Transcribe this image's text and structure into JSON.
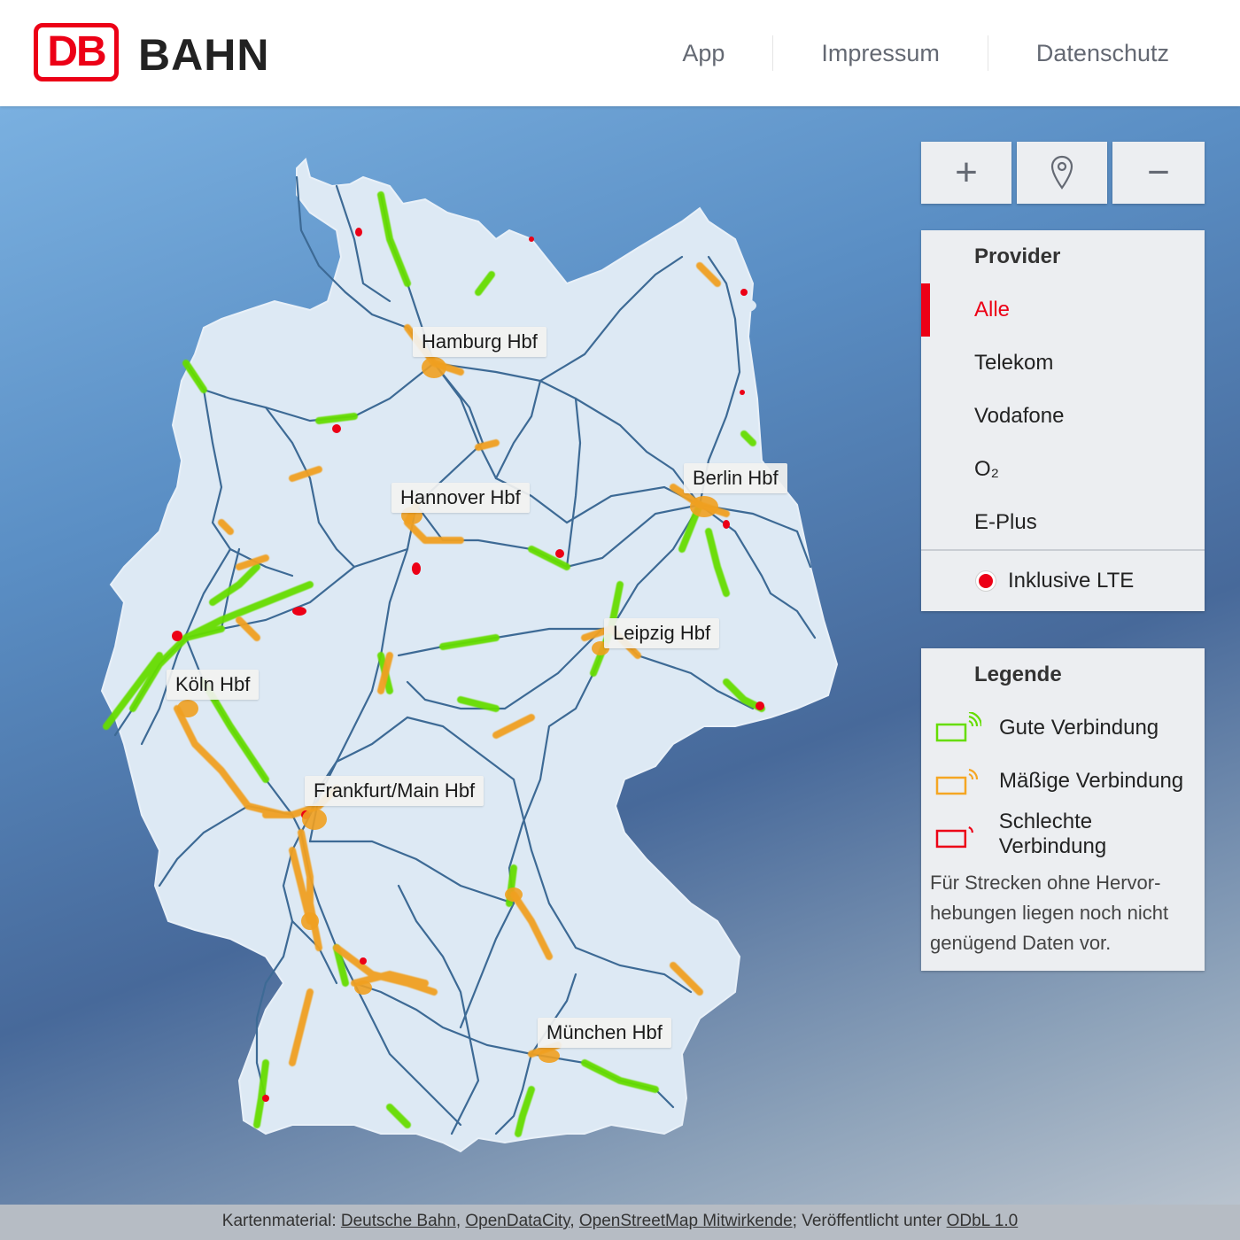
{
  "header": {
    "logo_text": "DB",
    "brand": "BAHN",
    "nav": [
      "App",
      "Impressum",
      "Datenschutz"
    ]
  },
  "map": {
    "cities": [
      {
        "name": "Hamburg Hbf"
      },
      {
        "name": "Hannover Hbf"
      },
      {
        "name": "Berlin Hbf"
      },
      {
        "name": "Leipzig Hbf"
      },
      {
        "name": "Köln Hbf"
      },
      {
        "name": "Frankfurt/Main Hbf"
      },
      {
        "name": "München Hbf"
      }
    ],
    "controls": {
      "zoom_in": "+",
      "locate_icon": "map-pin-icon",
      "zoom_out": "−"
    }
  },
  "provider": {
    "title": "Provider",
    "items": [
      "Alle",
      "Telekom",
      "Vodafone",
      "O₂",
      "E-Plus"
    ],
    "selected": "Alle",
    "lte_label": "Inklusive LTE",
    "lte_enabled": true
  },
  "legend": {
    "title": "Legende",
    "items": [
      {
        "label": "Gute Verbindung",
        "color": "#66dd00",
        "icon": "signal-green-icon"
      },
      {
        "label": "Mäßige Verbindung",
        "color": "#f5a623",
        "icon": "signal-orange-icon"
      },
      {
        "label": "Schlechte Verbindung",
        "color": "#ec0016",
        "icon": "signal-red-icon"
      }
    ],
    "note": "Für Strecken ohne Hervor-hebungen liegen noch nicht genügend Daten vor."
  },
  "footer": {
    "prefix": "Kartenmaterial:",
    "links": [
      "Deutsche Bahn",
      "OpenDataCity",
      "OpenStreetMap Mitwirkende"
    ],
    "published": "; Veröffentlicht unter",
    "license": "ODbL 1.0"
  },
  "colors": {
    "accent": "#ec0016",
    "good": "#66dd00",
    "medium": "#f5a623",
    "bad": "#ec0016",
    "rail": "#3d6a95",
    "land": "#dde9f4"
  }
}
